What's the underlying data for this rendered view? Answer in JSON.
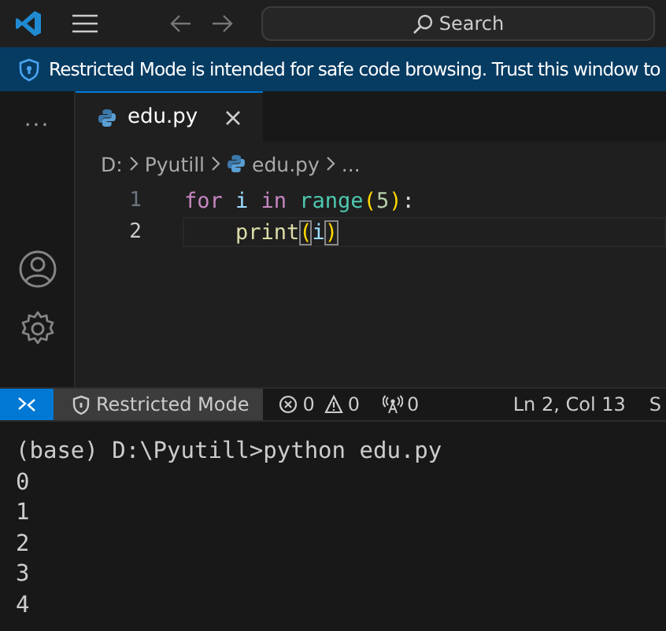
{
  "title_bar": {
    "search": {
      "placeholder": "Search"
    }
  },
  "banner": {
    "text": "Restricted Mode is intended for safe code browsing. Trust this window to"
  },
  "activity_bar": {
    "more": "···"
  },
  "tabs": [
    {
      "label": "edu.py",
      "selected": true
    }
  ],
  "breadcrumbs": [
    "D:",
    "Pyutill",
    "edu.py",
    "..."
  ],
  "code": [
    {
      "number": "1",
      "current": false,
      "tokens": [
        {
          "kind": "keyword",
          "text": "for "
        },
        {
          "kind": "variable",
          "text": "i "
        },
        {
          "kind": "keyword",
          "text": "in "
        },
        {
          "kind": "class",
          "text": "range"
        },
        {
          "kind": "bracket",
          "text": "("
        },
        {
          "kind": "number",
          "text": "5"
        },
        {
          "kind": "bracket",
          "text": ")"
        },
        {
          "kind": "plain",
          "text": ":"
        }
      ]
    },
    {
      "number": "2",
      "current": true,
      "tokens": [
        {
          "kind": "indent"
        },
        {
          "kind": "function",
          "text": "print"
        },
        {
          "kind": "match",
          "text": "("
        },
        {
          "kind": "variable",
          "text": "i"
        },
        {
          "kind": "match",
          "text": ")"
        }
      ]
    }
  ],
  "status_bar": {
    "restricted": "Restricted Mode",
    "errors": "0",
    "warnings": "0",
    "ports": "0",
    "position": "Ln 2, Col 13",
    "cut": "S"
  },
  "terminal": {
    "lines": [
      "(base) D:\\Pyutill>python edu.py",
      "0",
      "1",
      "2",
      "3",
      "4"
    ]
  }
}
